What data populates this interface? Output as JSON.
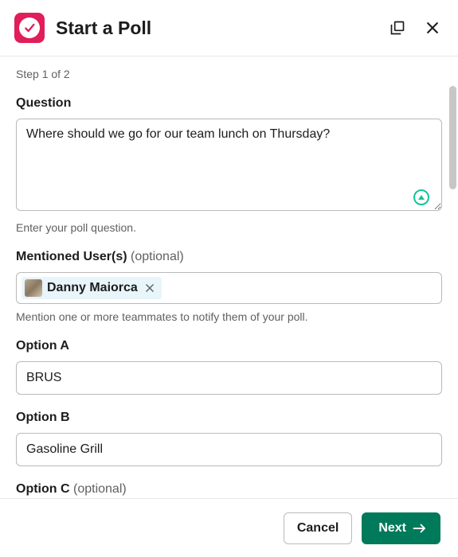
{
  "header": {
    "title": "Start a Poll"
  },
  "step": "Step 1 of 2",
  "question": {
    "label": "Question",
    "value": "Where should we go for our team lunch on Thursday?",
    "help": "Enter your poll question."
  },
  "mentions": {
    "label": "Mentioned User(s)",
    "optional": "(optional)",
    "users": [
      {
        "name": "Danny Maiorca"
      }
    ],
    "help": "Mention one or more teammates to notify them of your poll."
  },
  "optionA": {
    "label": "Option A",
    "value": "BRUS"
  },
  "optionB": {
    "label": "Option B",
    "value": "Gasoline Grill"
  },
  "optionC": {
    "label": "Option C",
    "optional": "(optional)",
    "value": ""
  },
  "footer": {
    "cancel": "Cancel",
    "next": "Next"
  }
}
